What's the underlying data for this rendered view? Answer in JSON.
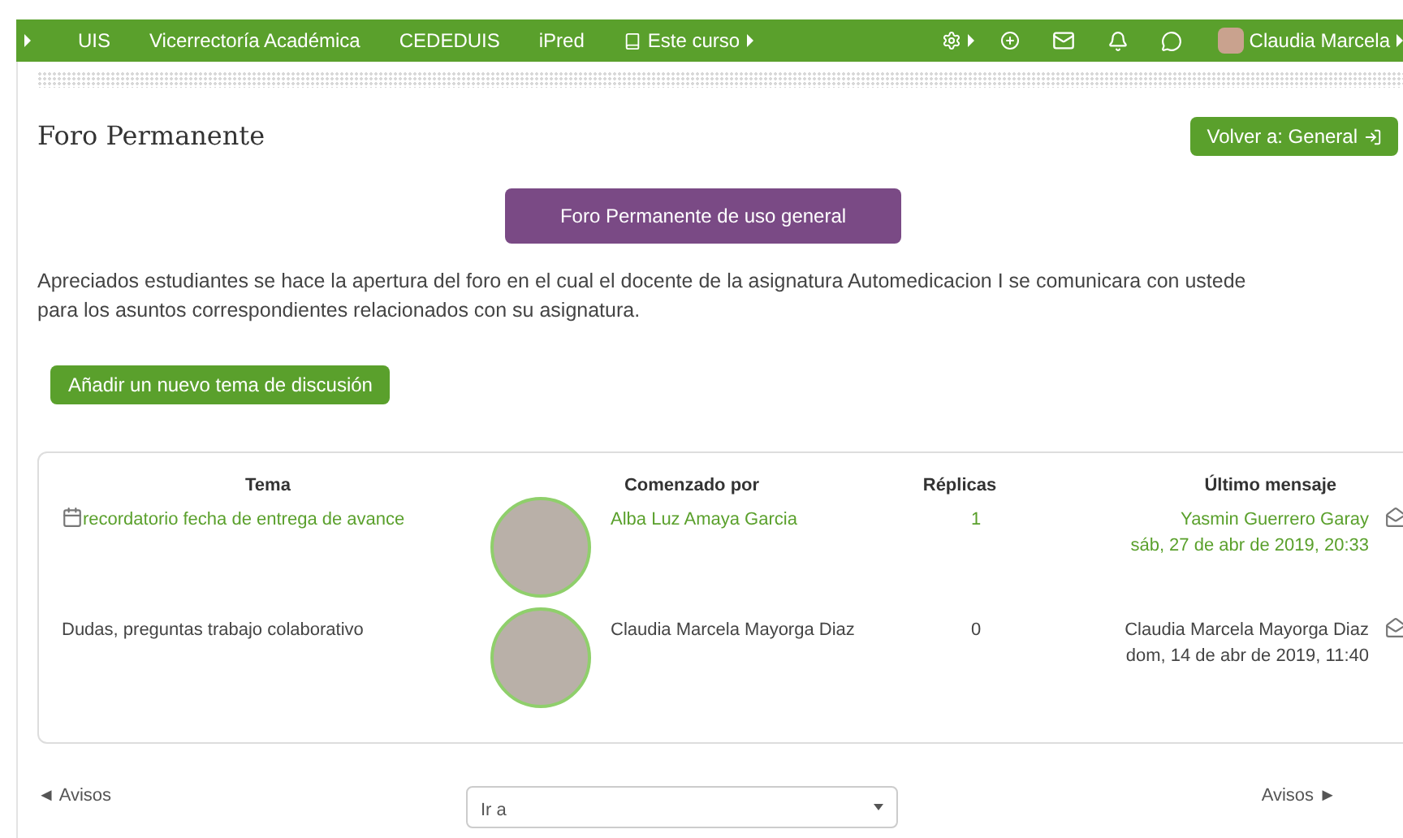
{
  "navbar": {
    "items": [
      {
        "label": "UIS"
      },
      {
        "label": "Vicerrectoría Académica"
      },
      {
        "label": "CEDEDUIS"
      },
      {
        "label": "iPred"
      },
      {
        "label": "Este curso",
        "kind": "menu"
      }
    ],
    "user": "Claudia Marcela"
  },
  "page": {
    "title": "Foro Permanente",
    "back_button": "Volver a: General",
    "forum_button": "Foro Permanente de uso general",
    "description": [
      "Apreciados estudiantes se hace la apertura del foro en el cual el docente de la asignatura Automedicacion I se comunicara con ustede",
      "para los asuntos correspondientes relacionados con su asignatura."
    ],
    "add_button": "Añadir un nuevo tema de discusión"
  },
  "table": {
    "columns": [
      "Tema",
      "Comenzado por",
      "Réplicas",
      "Último mensaje"
    ],
    "rows": [
      {
        "topic": "recordatorio fecha de entrega de avance",
        "timed": true,
        "highlighted": true,
        "author": "Alba Luz Amaya Garcia",
        "replies": "1",
        "last_author": "Yasmin Guerrero Garay",
        "last_date": "sáb, 27 de abr de 2019, 20:33"
      },
      {
        "topic": "Dudas, preguntas trabajo colaborativo",
        "timed": false,
        "highlighted": false,
        "author": "Claudia Marcela Mayorga Diaz",
        "replies": "0",
        "last_author": "Claudia Marcela Mayorga Diaz",
        "last_date": "dom, 14 de abr de 2019, 11:40"
      }
    ]
  },
  "footer": {
    "prev": "◄ Avisos",
    "jump": "Ir a",
    "next": "Avisos ►"
  }
}
